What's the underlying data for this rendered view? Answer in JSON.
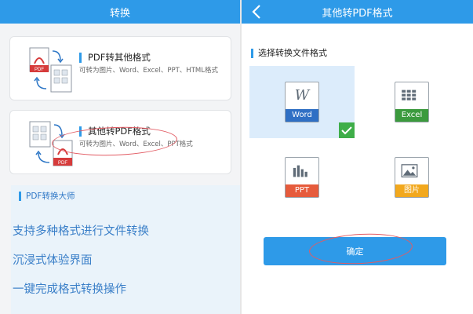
{
  "left": {
    "title": "转换",
    "card1": {
      "title": "PDF转其他格式",
      "desc": "可转为图片、Word、Excel、PPT、HTML格式"
    },
    "card2": {
      "title": "其他转PDF格式",
      "desc": "可转为图片、Word、Excel、PPT格式"
    },
    "promo": {
      "header": "PDF转换大师",
      "features": [
        "支持多种格式进行文件转换",
        "沉浸式体验界面",
        "一键完成格式转换操作"
      ]
    },
    "pdf_badge": "PDF"
  },
  "right": {
    "title": "其他转PDF格式",
    "section_title": "选择转换文件格式",
    "formats": [
      {
        "label": "Word",
        "color": "#2f6fc4",
        "icon": "word-icon",
        "selected": true
      },
      {
        "label": "Excel",
        "color": "#3b9a3d",
        "icon": "excel-icon",
        "selected": false
      },
      {
        "label": "PPT",
        "color": "#e65b3c",
        "icon": "ppt-icon",
        "selected": false
      },
      {
        "label": "图片",
        "color": "#f2a81d",
        "icon": "image-icon",
        "selected": false
      }
    ],
    "confirm_label": "确定"
  },
  "colors": {
    "accent": "#2e9ae8",
    "annotation": "#e25b63"
  }
}
